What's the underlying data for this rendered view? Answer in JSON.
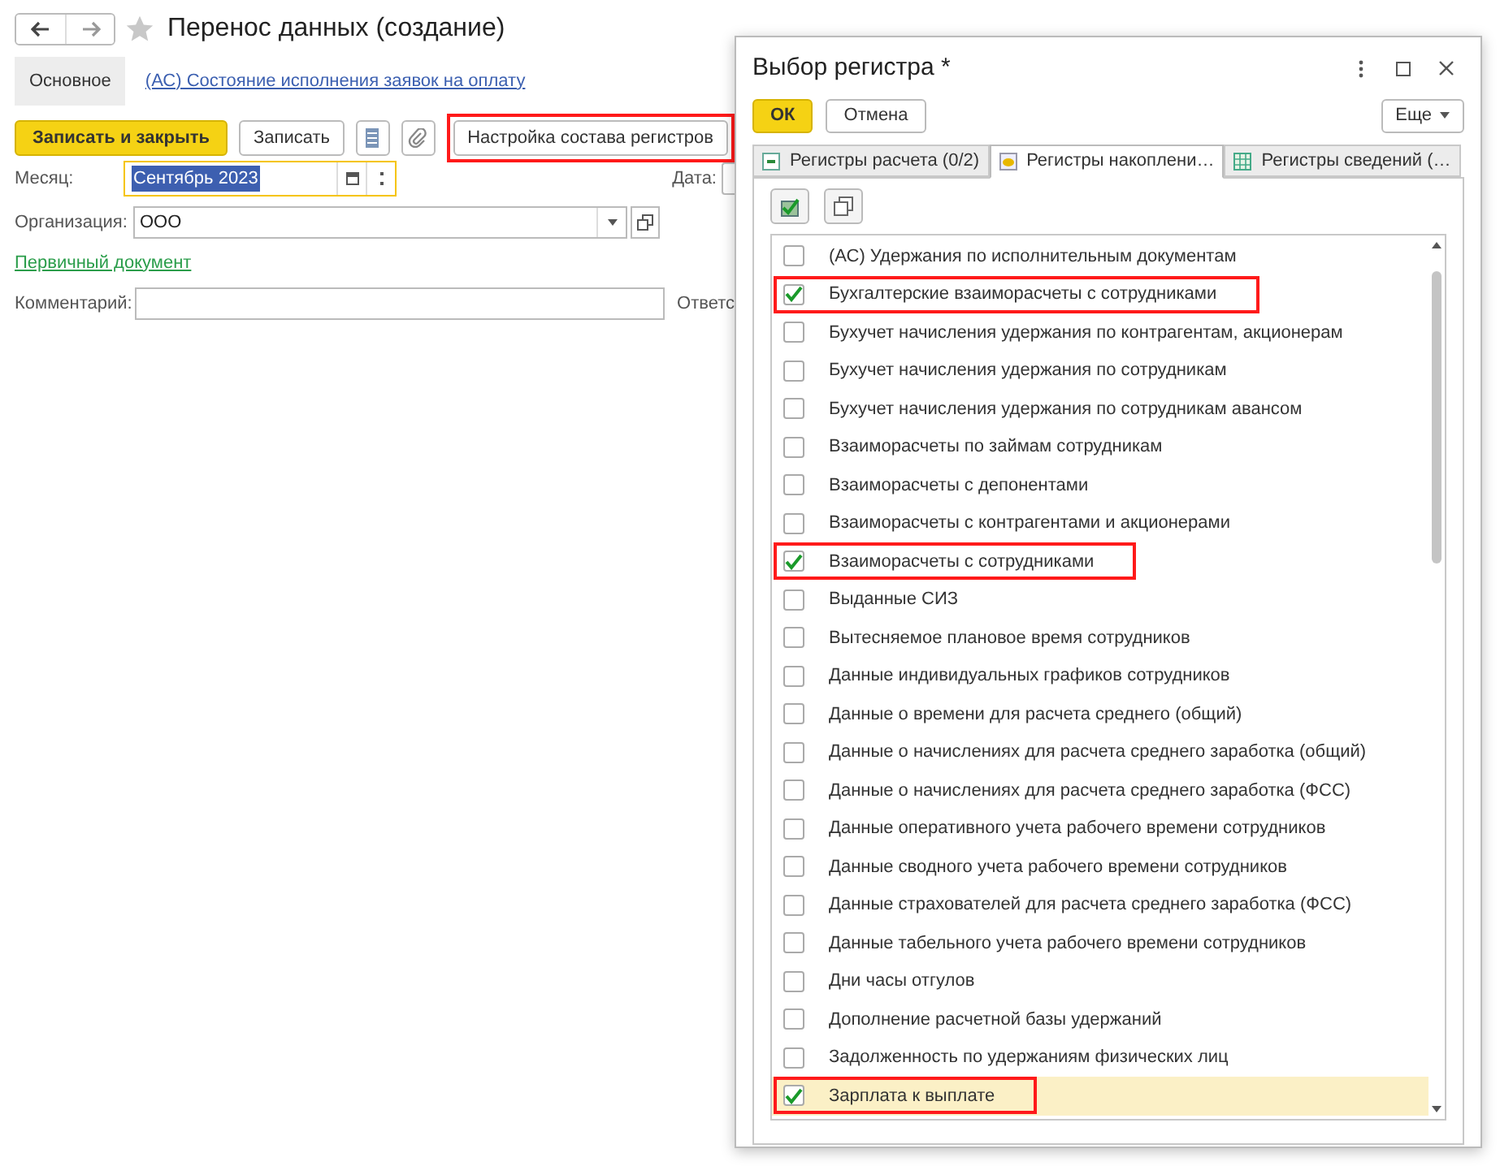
{
  "form": {
    "title": "Перенос данных (создание)",
    "sections": [
      {
        "label": "Основное",
        "selected": true
      },
      {
        "label": "(АС) Состояние исполнения заявок на оплату",
        "selected": false
      }
    ],
    "toolbar": [
      {
        "kind": "primary",
        "label": "Записать и закрыть",
        "highlighted": false
      },
      {
        "kind": "plain",
        "label": "Записать",
        "highlighted": false
      },
      {
        "kind": "list-icon"
      },
      {
        "kind": "clip-icon"
      },
      {
        "kind": "plain",
        "label": "Настройка состава регистров",
        "highlighted": true
      }
    ],
    "month": {
      "label": "Месяц:",
      "value": "Сентябрь 2023"
    },
    "date": {
      "label": "Дата:"
    },
    "organization": {
      "label": "Организация:",
      "value": "ООО"
    },
    "primary_document_link": "Первичный документ",
    "comment": {
      "label": "Комментарий:"
    },
    "responsible": {
      "label": "Ответс"
    }
  },
  "dialog": {
    "title": "Выбор регистра *",
    "buttons": [
      {
        "kind": "primary",
        "label": "ОК"
      },
      {
        "kind": "plain",
        "label": "Отмена"
      }
    ],
    "more": "Еще",
    "tabs": [
      {
        "label": "Регистры расчета (0/2)",
        "selected": false
      },
      {
        "label": "Регистры накоплени…",
        "selected": true
      },
      {
        "label": "Регистры сведений (…",
        "selected": false
      }
    ],
    "registers": [
      {
        "name": "(АС) Удержания по исполнительным документам",
        "checked": false,
        "highlighted": false,
        "selected": false
      },
      {
        "name": "Бухгалтерские взаиморасчеты с сотрудниками",
        "checked": true,
        "highlighted": true,
        "selected": false
      },
      {
        "name": "Бухучет начисления удержания по контрагентам, акционерам",
        "checked": false,
        "highlighted": false,
        "selected": false
      },
      {
        "name": "Бухучет начисления удержания по сотрудникам",
        "checked": false,
        "highlighted": false,
        "selected": false
      },
      {
        "name": "Бухучет начисления удержания по сотрудникам авансом",
        "checked": false,
        "highlighted": false,
        "selected": false
      },
      {
        "name": "Взаиморасчеты по займам сотрудникам",
        "checked": false,
        "highlighted": false,
        "selected": false
      },
      {
        "name": "Взаиморасчеты с депонентами",
        "checked": false,
        "highlighted": false,
        "selected": false
      },
      {
        "name": "Взаиморасчеты с контрагентами и акционерами",
        "checked": false,
        "highlighted": false,
        "selected": false
      },
      {
        "name": "Взаиморасчеты с сотрудниками",
        "checked": true,
        "highlighted": true,
        "selected": false
      },
      {
        "name": "Выданные СИЗ",
        "checked": false,
        "highlighted": false,
        "selected": false
      },
      {
        "name": "Вытесняемое плановое время сотрудников",
        "checked": false,
        "highlighted": false,
        "selected": false
      },
      {
        "name": "Данные индивидуальных графиков сотрудников",
        "checked": false,
        "highlighted": false,
        "selected": false
      },
      {
        "name": "Данные о времени для расчета среднего (общий)",
        "checked": false,
        "highlighted": false,
        "selected": false
      },
      {
        "name": "Данные о начислениях для расчета среднего заработка (общий)",
        "checked": false,
        "highlighted": false,
        "selected": false
      },
      {
        "name": "Данные о начислениях для расчета среднего заработка (ФСС)",
        "checked": false,
        "highlighted": false,
        "selected": false
      },
      {
        "name": "Данные оперативного учета рабочего времени сотрудников",
        "checked": false,
        "highlighted": false,
        "selected": false
      },
      {
        "name": "Данные сводного учета рабочего времени сотрудников",
        "checked": false,
        "highlighted": false,
        "selected": false
      },
      {
        "name": "Данные страхователей для расчета среднего заработка (ФСС)",
        "checked": false,
        "highlighted": false,
        "selected": false
      },
      {
        "name": "Данные табельного учета рабочего времени сотрудников",
        "checked": false,
        "highlighted": false,
        "selected": false
      },
      {
        "name": "Дни часы отгулов",
        "checked": false,
        "highlighted": false,
        "selected": false
      },
      {
        "name": "Дополнение расчетной базы удержаний",
        "checked": false,
        "highlighted": false,
        "selected": false
      },
      {
        "name": "Задолженность по удержаниям физических лиц",
        "checked": false,
        "highlighted": false,
        "selected": false
      },
      {
        "name": "Зарплата к выплате",
        "checked": true,
        "highlighted": true,
        "selected": true
      }
    ]
  }
}
